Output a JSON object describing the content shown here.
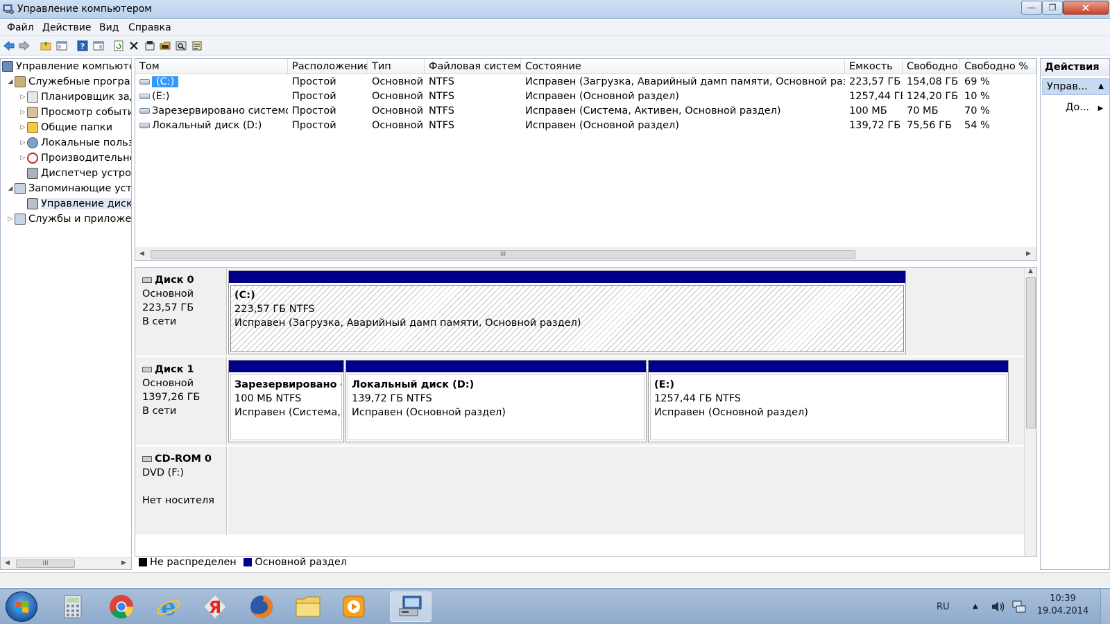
{
  "window": {
    "title": "Управление компьютером",
    "min_glyph": "—",
    "max_glyph": "❐",
    "close_glyph": "✕"
  },
  "menu": [
    "Файл",
    "Действие",
    "Вид",
    "Справка"
  ],
  "toolbar": {
    "icons": [
      "back-icon",
      "forward-icon",
      "up-folder-icon",
      "show-hide-tree-icon",
      "help-icon",
      "properties-pane-icon",
      "refresh-icon",
      "delete-icon",
      "properties-icon",
      "open-icon",
      "search-icon",
      "export-icon"
    ]
  },
  "tree": {
    "items": [
      {
        "label": "Управление компьютером (локальным)",
        "level": 0,
        "expander": "",
        "icon": "computer-icon"
      },
      {
        "label": "Служебные программы",
        "level": 1,
        "expander": "◢",
        "icon": "tools-icon"
      },
      {
        "label": "Планировщик заданий",
        "level": 2,
        "expander": "▷",
        "icon": "scheduler-icon"
      },
      {
        "label": "Просмотр событий",
        "level": 2,
        "expander": "▷",
        "icon": "event-viewer-icon"
      },
      {
        "label": "Общие папки",
        "level": 2,
        "expander": "▷",
        "icon": "shared-folders-icon"
      },
      {
        "label": "Локальные пользователи",
        "level": 2,
        "expander": "▷",
        "icon": "users-icon"
      },
      {
        "label": "Производительность",
        "level": 2,
        "expander": "▷",
        "icon": "performance-icon"
      },
      {
        "label": "Диспетчер устройств",
        "level": 2,
        "expander": "",
        "icon": "device-manager-icon"
      },
      {
        "label": "Запоминающие устройства",
        "level": 1,
        "expander": "◢",
        "icon": "storage-icon"
      },
      {
        "label": "Управление дисками",
        "level": 2,
        "expander": "",
        "icon": "disk-management-icon",
        "selected": true
      },
      {
        "label": "Службы и приложения",
        "level": 1,
        "expander": "▷",
        "icon": "services-icon"
      }
    ],
    "scroll_glyph": "III"
  },
  "volumes": {
    "columns": [
      "Том",
      "Расположение",
      "Тип",
      "Файловая система",
      "Состояние",
      "Емкость",
      "Свободно",
      "Свободно %"
    ],
    "rows": [
      {
        "name": "(C:)",
        "layout": "Простой",
        "type": "Основной",
        "fs": "NTFS",
        "status": "Исправен (Загрузка, Аварийный дамп памяти, Основной раздел)",
        "capacity": "223,57 ГБ",
        "free": "154,08 ГБ",
        "free_pct": "69 %",
        "selected": true
      },
      {
        "name": "(E:)",
        "layout": "Простой",
        "type": "Основной",
        "fs": "NTFS",
        "status": "Исправен (Основной раздел)",
        "capacity": "1257,44 ГБ",
        "free": "124,20 ГБ",
        "free_pct": "10 %"
      },
      {
        "name": "Зарезервировано системой",
        "layout": "Простой",
        "type": "Основной",
        "fs": "NTFS",
        "status": "Исправен (Система, Активен, Основной раздел)",
        "capacity": "100 МБ",
        "free": "70 МБ",
        "free_pct": "70 %"
      },
      {
        "name": "Локальный диск (D:)",
        "layout": "Простой",
        "type": "Основной",
        "fs": "NTFS",
        "status": "Исправен (Основной раздел)",
        "capacity": "139,72 ГБ",
        "free": "75,56 ГБ",
        "free_pct": "54 %"
      }
    ],
    "scroll_glyph": "III"
  },
  "disks": [
    {
      "name": "Диск 0",
      "kind": "Основной",
      "size": "223,57 ГБ",
      "state": "В сети",
      "partitions": [
        {
          "title": "(C:)",
          "size": "223,57 ГБ NTFS",
          "status": "Исправен (Загрузка, Аварийный дамп памяти, Основной раздел)"
        }
      ]
    },
    {
      "name": "Диск 1",
      "kind": "Основной",
      "size": "1397,26 ГБ",
      "state": "В сети",
      "partitions": [
        {
          "title": "Зарезервировано системой",
          "size": "100 МБ NTFS",
          "status": "Исправен (Система, Активен, Основной раздел)"
        },
        {
          "title": "Локальный диск  (D:)",
          "size": "139,72 ГБ NTFS",
          "status": "Исправен (Основной раздел)"
        },
        {
          "title": "(E:)",
          "size": "1257,44 ГБ NTFS",
          "status": "Исправен (Основной раздел)"
        }
      ]
    },
    {
      "name": "CD-ROM 0",
      "kind": "DVD (F:)",
      "size": "",
      "state": "Нет носителя",
      "partitions": []
    }
  ],
  "legend": [
    {
      "label": "Не распределен",
      "color": "#000000"
    },
    {
      "label": "Основной раздел",
      "color": "#00008b"
    }
  ],
  "actions": {
    "title": "Действия",
    "group": "Управ...",
    "more": "До..."
  },
  "taskbar": {
    "apps": [
      "calculator-icon",
      "chrome-icon",
      "internet-explorer-icon",
      "yandex-browser-icon",
      "firefox-icon",
      "explorer-icon",
      "media-player-icon",
      "computer-management-icon"
    ],
    "language": "RU",
    "time": "10:39",
    "date": "19.04.2014"
  },
  "colors": {
    "primary_partition": "#00008b",
    "selection": "#3399ff"
  }
}
